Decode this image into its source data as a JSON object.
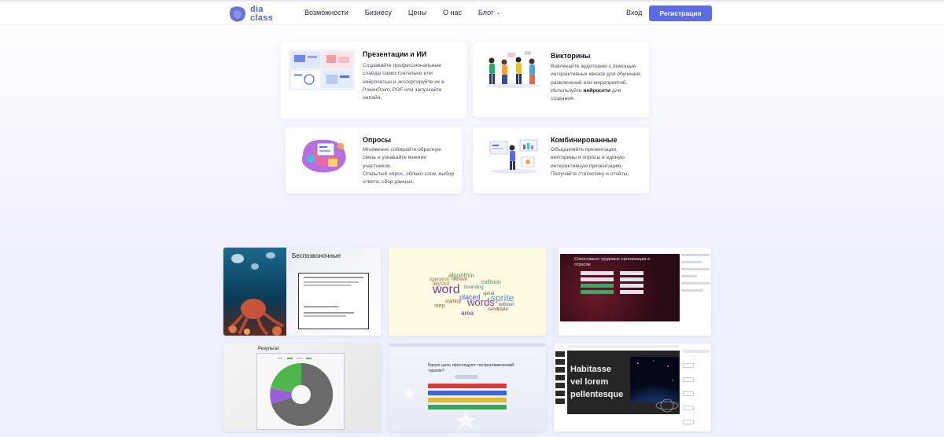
{
  "header": {
    "logo_line1": "dia",
    "logo_line2": "class",
    "nav": [
      {
        "label": "Возможности"
      },
      {
        "label": "Бизнесу"
      },
      {
        "label": "Цены"
      },
      {
        "label": "О нас"
      },
      {
        "label": "Блог"
      }
    ],
    "login_label": "Вход",
    "signup_label": "Регистрация"
  },
  "features": [
    {
      "title": "Презентации и ИИ",
      "text": "Создавайте профессиональные слайды самостоятельно или нейросетью и экспортируйте их в PowerPoint, PDF или запускайте онлайн."
    },
    {
      "title": "Викторины",
      "text_main": "Вовлекайте аудиторию с помощью интерактивных квизов для обучения, развлечений или мероприятий.",
      "text_pre": "Используйте ",
      "text_bold": "нейросети",
      "text_post": " для создания."
    },
    {
      "title": "Опросы",
      "text": "Мгновенно собирайте обратную связь и узнавайте мнение участников.",
      "text2": "Открытый опрос, облако слов, выбор ответа, сбор данных."
    },
    {
      "title": "Комбинированные",
      "text": "Объединяйте презентации, викторины и опросы в единую интерактивную презентацию. Получайте статистику и отчёты."
    }
  ],
  "thumbnails": [
    {
      "title": "Беспозвоночные"
    },
    {
      "words": [
        "word",
        "algorithm",
        "sprite",
        "words",
        "placed",
        "layout",
        "collision",
        "area",
        "step",
        "retrieve",
        "bounding",
        "candidate",
        "without",
        "operation",
        "starting",
        "spiral"
      ]
    },
    {
      "question": "Сопоставьте трудовые организации в отрасли"
    },
    {
      "title": "Результат"
    },
    {
      "question": "Какую цель преследуют гастрономический туризм?"
    },
    {
      "text_line1": "Habitasse",
      "text_line2": "vel lorem",
      "text_line3": "pellentesque"
    }
  ],
  "colors": {
    "accent": "#5c6de3",
    "logo": "#5a63c9"
  }
}
